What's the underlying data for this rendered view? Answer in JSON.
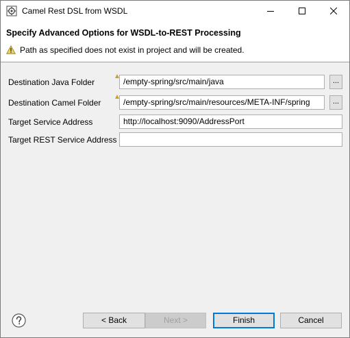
{
  "window": {
    "title": "Camel Rest DSL from WSDL"
  },
  "banner": {
    "title": "Specify Advanced Options for WSDL-to-REST Processing",
    "message": "Path as specified does not exist in project and will be created."
  },
  "form": {
    "java_folder": {
      "label": "Destination Java Folder",
      "value": "/empty-spring/src/main/java",
      "browse_label": "..."
    },
    "camel_folder": {
      "label": "Destination Camel Folder",
      "value": "/empty-spring/src/main/resources/META-INF/spring",
      "browse_label": "..."
    },
    "service_address": {
      "label": "Target Service Address",
      "value": "http://localhost:9090/AddressPort"
    },
    "rest_address": {
      "label": "Target REST Service Address",
      "value": ""
    }
  },
  "buttons": {
    "back": "< Back",
    "next": "Next >",
    "finish": "Finish",
    "cancel": "Cancel"
  },
  "icons": {
    "app": "camel-app-icon",
    "warning": "warning-icon",
    "help": "help-icon"
  },
  "colors": {
    "default_button_border": "#0078d7",
    "warning_fill": "#f5d34b"
  }
}
